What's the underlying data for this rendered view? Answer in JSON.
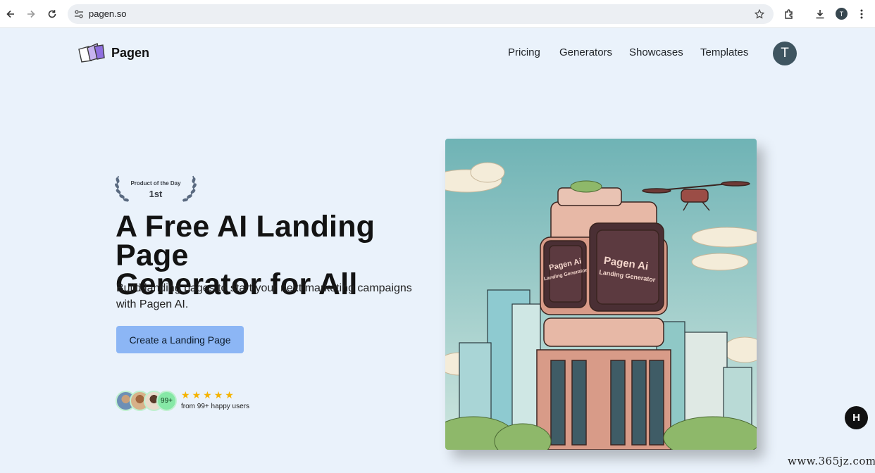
{
  "browser": {
    "url": "pagen.so",
    "profile_initial": "T"
  },
  "header": {
    "logo_text": "Pagen",
    "nav": [
      {
        "label": "Pricing"
      },
      {
        "label": "Generators"
      },
      {
        "label": "Showcases"
      },
      {
        "label": "Templates"
      }
    ],
    "avatar_initial": "T"
  },
  "hero": {
    "badge_title": "Product of the Day",
    "badge_rank": "1st",
    "headline_line1": "A Free AI Landing Page",
    "headline_line2": "Generator for All",
    "subtitle": "Build landing pages to start your next marketing campaigns with Pagen AI.",
    "cta_label": "Create a Landing Page",
    "avatar_more": "99+",
    "rating_stars": 5,
    "happy_users": "from 99+ happy users"
  },
  "image": {
    "screen_left_text": "Pagen Ai",
    "screen_left_sub": "Landing Generator",
    "screen_right_text": "Pagen Ai",
    "screen_right_sub": "Landing Generator"
  },
  "floating_button": {
    "label": "H"
  },
  "watermark": "www.365jz.com",
  "colors": {
    "page_bg": "#eaf2fb",
    "cta_bg": "#8cb6f5",
    "star": "#f5b301",
    "avatar_bg": "#3f5560"
  }
}
